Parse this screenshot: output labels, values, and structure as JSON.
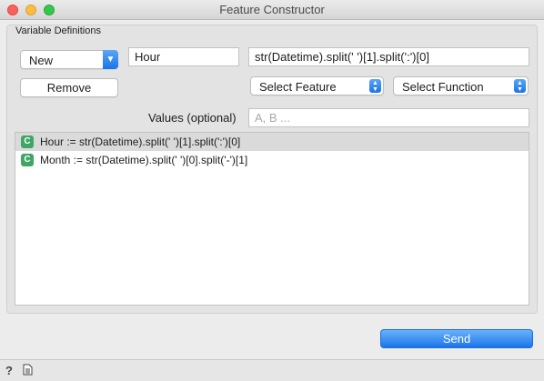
{
  "window": {
    "title": "Feature Constructor"
  },
  "group": {
    "label": "Variable Definitions"
  },
  "new_combo": {
    "value": "New"
  },
  "name_field": {
    "value": "Hour"
  },
  "expression_field": {
    "value": "str(Datetime).split(' ')[1].split(':')[0]"
  },
  "remove_button": {
    "label": "Remove"
  },
  "select_feature": {
    "value": "Select Feature"
  },
  "select_function": {
    "value": "Select Function"
  },
  "values": {
    "label": "Values (optional)",
    "placeholder": "A, B ..."
  },
  "definitions": [
    {
      "type": "C",
      "text": "Hour := str(Datetime).split(' ')[1].split(':')[0]",
      "selected": true
    },
    {
      "type": "C",
      "text": "Month := str(Datetime).split(' ')[0].split('-')[1]",
      "selected": false
    }
  ],
  "send_button": {
    "label": "Send"
  },
  "status_icons": [
    "help-icon",
    "report-icon"
  ],
  "colors": {
    "accent": "#1a74e8",
    "badge": "#3fa665",
    "selected_row": "#dadada"
  }
}
